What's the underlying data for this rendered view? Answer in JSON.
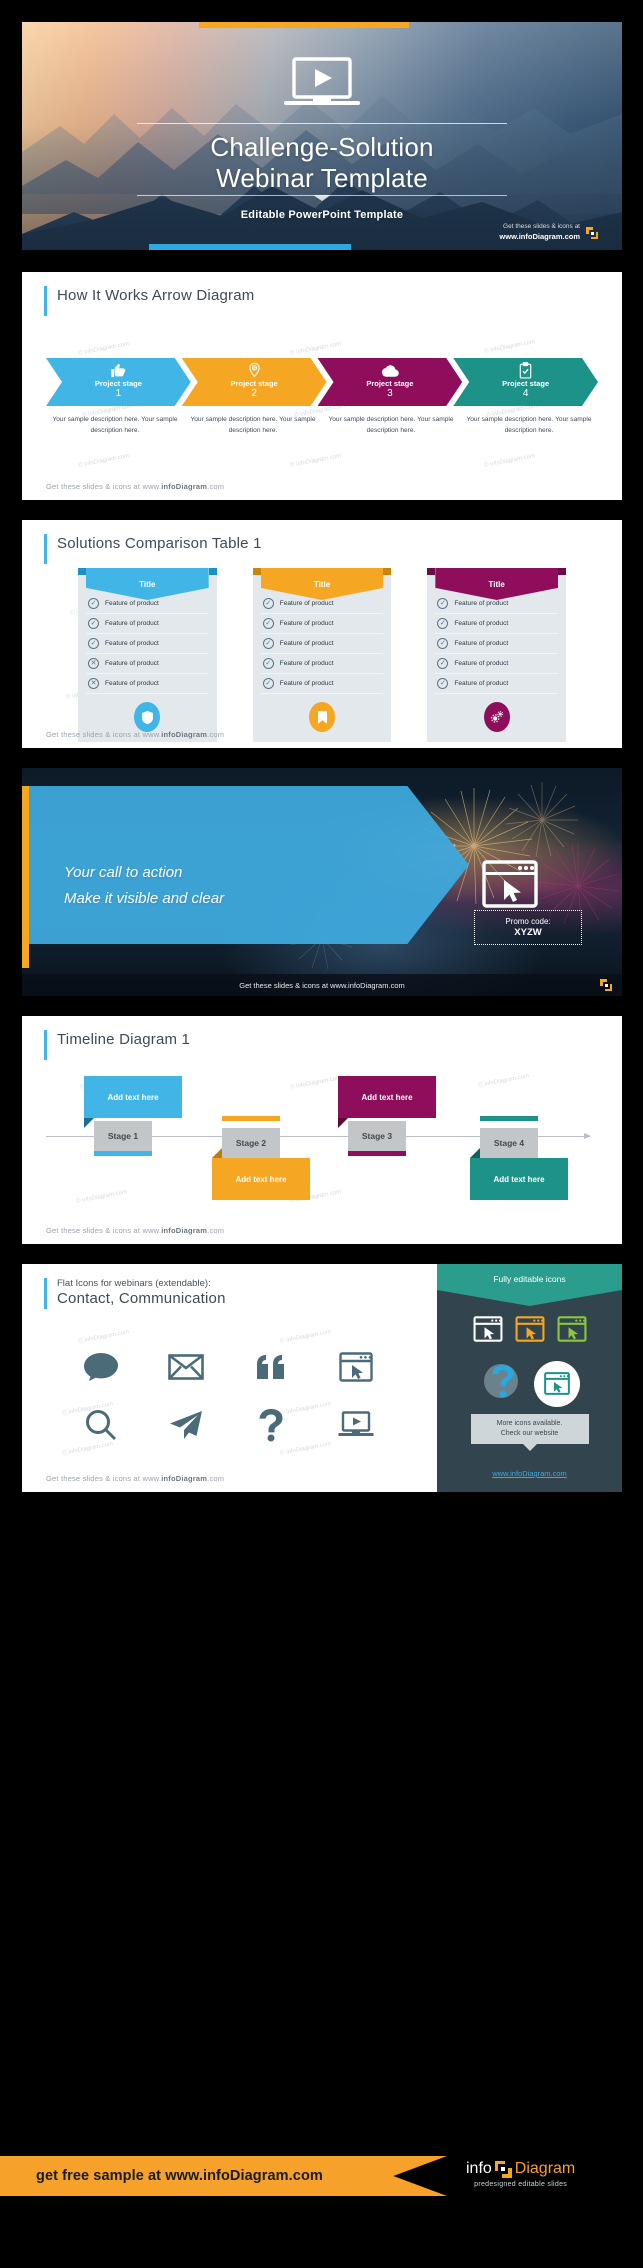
{
  "brand": {
    "footer_line1": "Get these slides & icons at",
    "footer_line2": "www.infoDiagram.com",
    "footer_plain_pre": "Get these slides & icons at www.",
    "footer_plain_bold": "infoDiagram",
    "footer_plain_post": ".com",
    "logo_info": "info",
    "logo_diagram": "Diagram",
    "logo_tagline": "predesigned editable slides",
    "accent_blue": "#41b6e6",
    "accent_orange": "#f5a623"
  },
  "slide1": {
    "name": "title-slide",
    "title_line1": "Challenge-Solution",
    "title_line2": "Webinar Template",
    "subtitle": "Editable PowerPoint Template",
    "icon": "laptop-play-icon"
  },
  "slide2": {
    "name": "how-it-works-arrow-diagram",
    "title": "How It Works Arrow Diagram",
    "stages": [
      {
        "label": "Project stage",
        "number": "1",
        "color": "#41b6e6",
        "color_dark": "#2ea0d6",
        "icon": "thumbs-up-icon",
        "description": "Your sample description here. Your sample description here."
      },
      {
        "label": "Project stage",
        "number": "2",
        "color": "#f5a623",
        "color_dark": "#dd8f0c",
        "icon": "lightbulb-location-icon",
        "description": "Your sample description here. Your sample description here."
      },
      {
        "label": "Project stage",
        "number": "3",
        "color": "#8e0e5c",
        "color_dark": "#7a0b4f",
        "icon": "cloud-icon",
        "description": "Your sample description here. Your sample description here."
      },
      {
        "label": "Project stage",
        "number": "4",
        "color": "#1c9289",
        "color_dark": "#167a72",
        "icon": "clipboard-check-icon",
        "description": "Your sample description here. Your sample description here."
      }
    ],
    "watermark": "© infoDiagram.com"
  },
  "slide3": {
    "name": "solutions-comparison-table",
    "title": "Solutions Comparison Table 1",
    "columns": [
      {
        "title": "Title",
        "color": "#41b6e6",
        "fold": "#1d8fc4",
        "badge_icon": "shield-icon",
        "features": [
          {
            "label": "Feature of product",
            "mark": "check"
          },
          {
            "label": "Feature of product",
            "mark": "check"
          },
          {
            "label": "Feature of product",
            "mark": "check"
          },
          {
            "label": "Feature of product",
            "mark": "cross"
          },
          {
            "label": "Feature of product",
            "mark": "cross"
          }
        ]
      },
      {
        "title": "Title",
        "color": "#f5a623",
        "fold": "#c8860f",
        "badge_icon": "bookmark-icon",
        "features": [
          {
            "label": "Feature of product",
            "mark": "check"
          },
          {
            "label": "Feature of product",
            "mark": "check"
          },
          {
            "label": "Feature of product",
            "mark": "check"
          },
          {
            "label": "Feature of product",
            "mark": "check"
          },
          {
            "label": "Feature of product",
            "mark": "check"
          }
        ]
      },
      {
        "title": "Title",
        "color": "#8e0e5c",
        "fold": "#6b0a45",
        "badge_icon": "gears-icon",
        "features": [
          {
            "label": "Feature of product",
            "mark": "check"
          },
          {
            "label": "Feature of product",
            "mark": "check"
          },
          {
            "label": "Feature of product",
            "mark": "check"
          },
          {
            "label": "Feature of product",
            "mark": "check"
          },
          {
            "label": "Feature of product",
            "mark": "check"
          }
        ]
      }
    ],
    "check_glyph": "✓",
    "cross_glyph": "✕"
  },
  "slide4": {
    "name": "call-to-action-slide",
    "line1": "Your call to action",
    "line2": "Make it visible and clear",
    "promo_label": "Promo code:",
    "promo_code": "XYZW",
    "icon": "browser-cursor-icon",
    "footer": "Get these slides & icons at www.infoDiagram.com"
  },
  "slide5": {
    "name": "timeline-diagram",
    "title": "Timeline Diagram 1",
    "stages": [
      {
        "stage": "Stage 1",
        "text": "Add text here",
        "color": "#41b6e6",
        "fold": "#1b6f95",
        "position": "above"
      },
      {
        "stage": "Stage 2",
        "text": "Add text here",
        "color": "#f5a623",
        "fold": "#bb7d10",
        "position": "below"
      },
      {
        "stage": "Stage 3",
        "text": "Add text here",
        "color": "#8e0e5c",
        "fold": "#5c0939",
        "position": "above"
      },
      {
        "stage": "Stage 4",
        "text": "Add text here",
        "color": "#1c9289",
        "fold": "#0f6259",
        "position": "below"
      }
    ],
    "watermark": "© infoDiagram.com"
  },
  "slide6": {
    "name": "flat-icons-slide",
    "title_small": "Flat Icons for webinars (extendable):",
    "title_main": "Contact, Communication",
    "icons": [
      "speech-bubble-icon",
      "envelope-icon",
      "quote-icon",
      "browser-cursor-icon",
      "search-icon",
      "paper-plane-icon",
      "question-mark-icon",
      "laptop-play-icon"
    ],
    "side_heading": "Fully editable icons",
    "tile_colors": [
      "#ffffff",
      "#f5a623",
      "#8cc63f"
    ],
    "tip_line1": "More icons available.",
    "tip_line2": "Check our website",
    "site_link": "www.infoDiagram.com"
  },
  "banner": {
    "name": "bottom-promo-banner",
    "text": "get free sample at www.infoDiagram.com"
  }
}
